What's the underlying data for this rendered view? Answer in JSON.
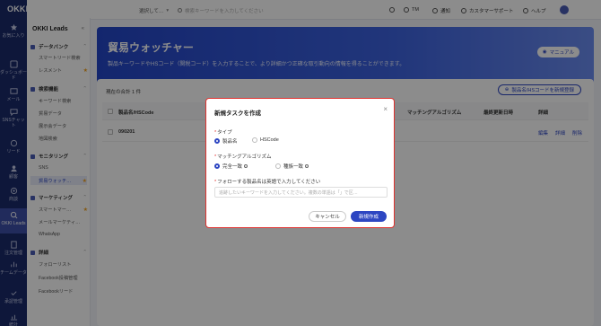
{
  "brand": {
    "logo": "OKKICRM"
  },
  "rail": [
    {
      "label": "お気に入り",
      "icon": "star-icon"
    },
    {
      "label": "ダッシュボード",
      "icon": "dashboard-icon"
    },
    {
      "label": "メール",
      "icon": "mail-icon"
    },
    {
      "label": "SNSチャット",
      "icon": "chat-icon"
    },
    {
      "label": "リード",
      "icon": "lead-icon"
    },
    {
      "label": "顧客",
      "icon": "customer-icon"
    },
    {
      "label": "商談",
      "icon": "deal-icon"
    },
    {
      "label": "OKKI Leads",
      "icon": "okki-leads-icon"
    },
    {
      "label": "注文管理",
      "icon": "order-icon"
    },
    {
      "label": "チームデータ",
      "icon": "team-data-icon"
    },
    {
      "label": "承認管理",
      "icon": "approval-icon"
    },
    {
      "label": "統計",
      "icon": "stats-icon"
    }
  ],
  "sidebar": {
    "title": "OKKI Leads",
    "groups": [
      {
        "label": "データバンク",
        "items": [
          {
            "label": "スマートリード検索",
            "star": false
          },
          {
            "label": "レスメント",
            "star": true
          }
        ]
      },
      {
        "label": "検索機能",
        "items": [
          {
            "label": "キーワード検索"
          },
          {
            "label": "貿易データ"
          },
          {
            "label": "展示会データ"
          },
          {
            "label": "地図検索"
          }
        ]
      },
      {
        "label": "モニタリング",
        "items": [
          {
            "label": "SNS"
          },
          {
            "label": "貿易ウォッチ…"
          }
        ]
      },
      {
        "label": "マーケティング",
        "items": [
          {
            "label": "スマートマー…"
          },
          {
            "label": "メールマーケティ…"
          },
          {
            "label": "WhatsApp"
          }
        ]
      },
      {
        "label": "詳細",
        "items": [
          {
            "label": "フォローリスト"
          },
          {
            "label": "Facebook投稿管理"
          },
          {
            "label": "Facebookリード"
          }
        ]
      }
    ]
  },
  "topbar": {
    "select": "選択して…",
    "search_placeholder": "検索キーワードを入力してください",
    "user": "TM",
    "notice": "通知",
    "support": "カスタマーサポート",
    "help": "ヘルプ"
  },
  "hero": {
    "title": "貿易ウォッチャー",
    "desc": "製品キーワードやHSコード（関税コード）を入力することで、より詳細かつ正確な取引動向の情報を得ることができます。",
    "manual": "マニュアル"
  },
  "panel": {
    "total_label": "現在の合計",
    "total_count": "1",
    "total_unit": "件",
    "register_btn": "製品名/HSコードを新規登録",
    "columns": [
      "製品名/HSCode",
      "マッチングアルゴリズム",
      "最終更新日時",
      "詳細"
    ],
    "rows": [
      {
        "product": "090201",
        "actions": [
          "編集",
          "詳細",
          "削除"
        ]
      }
    ]
  },
  "modal": {
    "title": "新規タスクを作成",
    "type_label": "タイプ",
    "type_options": [
      "製品名",
      "HSCode"
    ],
    "algo_label": "マッチングアルゴリズム",
    "algo_options": [
      "完全一致",
      "種族一致"
    ],
    "product_label": "フォローする製品名は英語で入力してください",
    "input_placeholder": "追跡したいキーワードを入力してください。複数の単語は「」で区…",
    "cancel": "キャンセル",
    "create": "新規作成"
  }
}
